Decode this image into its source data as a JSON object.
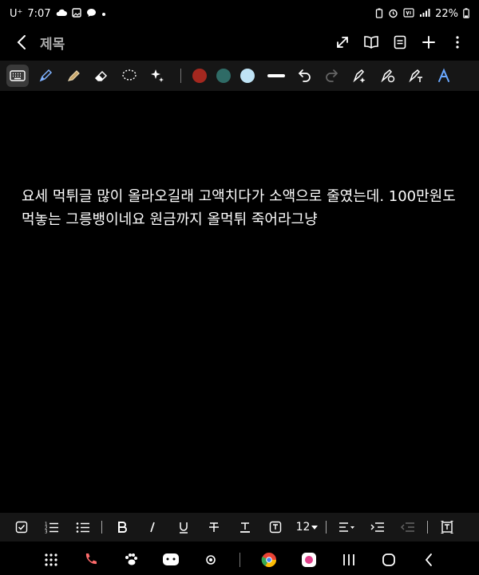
{
  "status_bar": {
    "carrier": "U⁺",
    "time": "7:07",
    "battery": "22%"
  },
  "header": {
    "title": "제목"
  },
  "toolbar": {
    "colors": [
      "#a4281f",
      "#2f6b66",
      "#bfe3f5"
    ]
  },
  "content": {
    "text": "요세 먹튀글 많이 올라오길래 고액치다가 소액으로 줄였는데. 100만원도 먹놓는 그릉뱅이네요 원금까지 올먹튀 죽어라그냥"
  },
  "format_bar": {
    "font_size": "12"
  },
  "icons": {
    "back": "back-chevron-icon",
    "expand": "expand-icon",
    "reading_mode": "book-icon",
    "page_template": "page-icon",
    "add": "plus-icon",
    "more": "more-vertical-icon"
  }
}
